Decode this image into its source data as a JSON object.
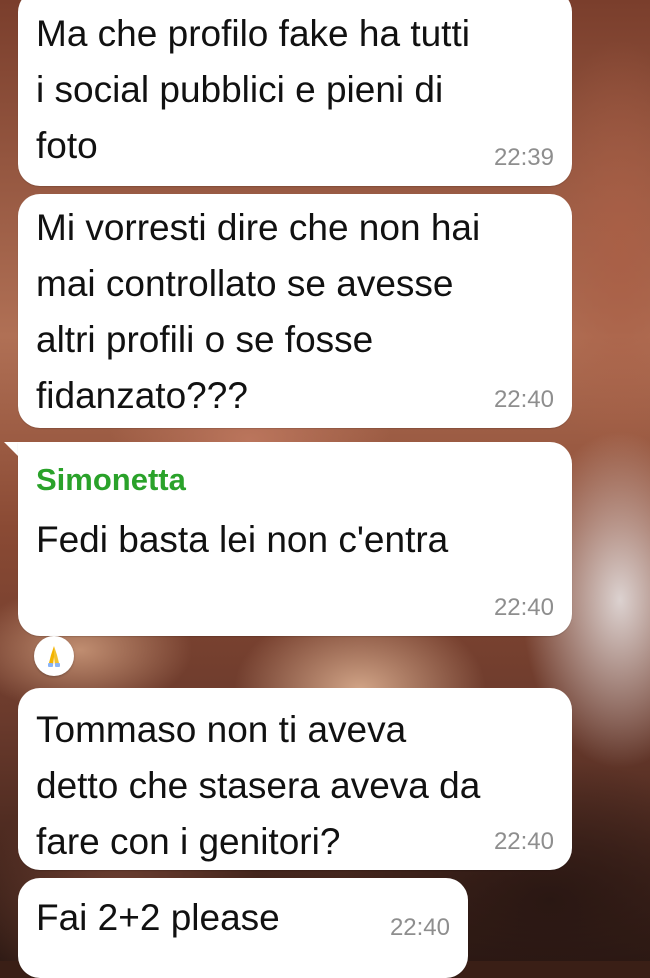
{
  "colors": {
    "bubble": "#ffffff",
    "text": "#111111",
    "timestamp": "#8e8e8e",
    "sender_name": "#2aa22a"
  },
  "messages": [
    {
      "text": "Ma che profilo fake ha tutti\ni social pubblici e pieni di\nfoto",
      "time": "22:39"
    },
    {
      "text": "Mi vorresti dire che non hai\nmai controllato se avesse\naltri profili o se fosse\nfidanzato???",
      "time": "22:40"
    },
    {
      "sender": "Simonetta",
      "text": "Fedi basta lei non c'entra",
      "time": "22:40",
      "reaction": "folded-hands-icon"
    },
    {
      "text": "Tommaso non ti aveva\ndetto che stasera aveva da\nfare con i genitori?",
      "time": "22:40"
    },
    {
      "text": "Fai 2+2 please",
      "time": "22:40"
    }
  ]
}
